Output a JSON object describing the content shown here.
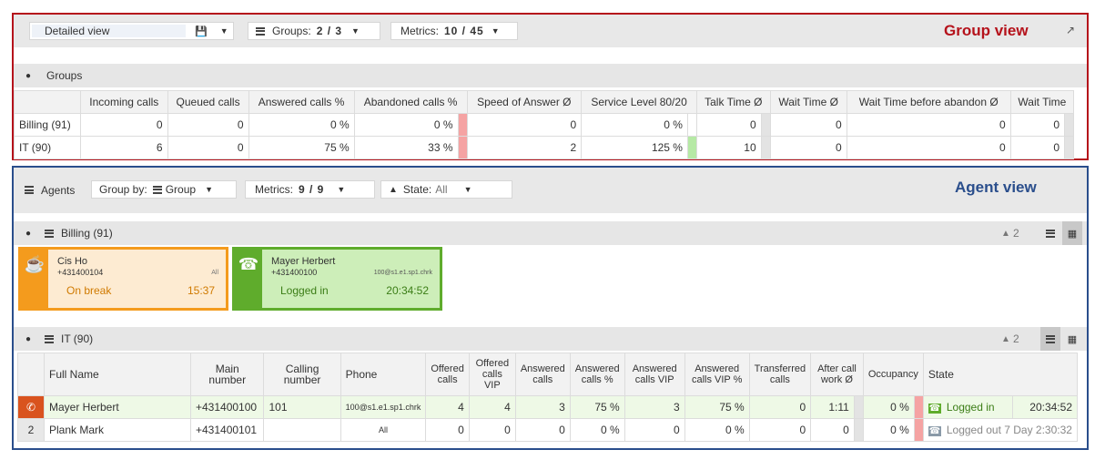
{
  "colors": {
    "group_border": "#b5121b",
    "agent_border": "#2a4e8c",
    "on_break": "#f49b1d",
    "logged_in": "#5fac2c",
    "abandon_bar": "#f5a3a3",
    "service_bar": "#b6e9a5"
  },
  "group_view": {
    "panel_title": "Group view",
    "toolbar": {
      "view_select": "Detailed view",
      "groups_label": "Groups:",
      "groups_value": "2 / 3",
      "metrics_label": "Metrics:",
      "metrics_value": "10 / 45"
    },
    "section_label": "Groups",
    "columns": [
      "Incoming calls",
      "Queued calls",
      "Answered calls %",
      "Abandoned calls %",
      "Speed of Answer Ø",
      "Service Level 80/20",
      "Talk Time Ø",
      "Wait Time Ø",
      "Wait Time before abandon Ø",
      "Wait Time"
    ],
    "rows": [
      {
        "name": "Billing (91)",
        "values": [
          "0",
          "0",
          "0 %",
          "0 %",
          "0",
          "0 %",
          "0",
          "0",
          "0",
          "0"
        ]
      },
      {
        "name": "IT (90)",
        "values": [
          "6",
          "0",
          "75 %",
          "33 %",
          "2",
          "125 %",
          "10",
          "0",
          "0",
          "0"
        ]
      }
    ]
  },
  "agent_view": {
    "panel_title": "Agent view",
    "toolbar": {
      "agents_label": "Agents",
      "group_by_label": "Group by:",
      "group_by_value": "Group",
      "metrics_label": "Metrics:",
      "metrics_value": "9 / 9",
      "state_label": "State:",
      "state_value": "All"
    },
    "billing": {
      "label": "Billing (91)",
      "agent_count": "2",
      "cards": [
        {
          "name": "Cis Ho",
          "number": "+431400104",
          "phone": "All",
          "state": "On break",
          "time": "15:37",
          "icon": "coffee-icon"
        },
        {
          "name": "Mayer Herbert",
          "number": "+431400100",
          "phone": "100@s1.e1.sp1.chrk",
          "state": "Logged in",
          "time": "20:34:52",
          "icon": "headset-icon"
        }
      ]
    },
    "it": {
      "label": "IT (90)",
      "agent_count": "2",
      "columns": [
        "Full Name",
        "Main number",
        "Calling number",
        "Phone",
        "Offered calls",
        "Offered calls VIP",
        "Answered calls",
        "Answered calls %",
        "Answered calls VIP",
        "Answered calls VIP %",
        "Transferred calls",
        "After call work Ø",
        "Occupancy",
        "State"
      ],
      "rows": [
        {
          "index": "",
          "name": "Mayer Herbert",
          "main": "+431400100",
          "calling": "101",
          "phone": "100@s1.e1.sp1.chrk",
          "offered": "4",
          "offered_vip": "4",
          "answered": "3",
          "answered_pct": "75 %",
          "answered_vip": "3",
          "answered_vip_pct": "75 %",
          "transferred": "0",
          "acw": "1:11",
          "occupancy": "0 %",
          "state": "Logged in",
          "state_time": "20:34:52"
        },
        {
          "index": "2",
          "name": "Plank Mark",
          "main": "+431400101",
          "calling": "",
          "phone": "All",
          "offered": "0",
          "offered_vip": "0",
          "answered": "0",
          "answered_pct": "0 %",
          "answered_vip": "0",
          "answered_vip_pct": "0 %",
          "transferred": "0",
          "acw": "0",
          "occupancy": "0 %",
          "state": "Logged out 7 Day 2:30:32",
          "state_time": ""
        }
      ]
    }
  }
}
